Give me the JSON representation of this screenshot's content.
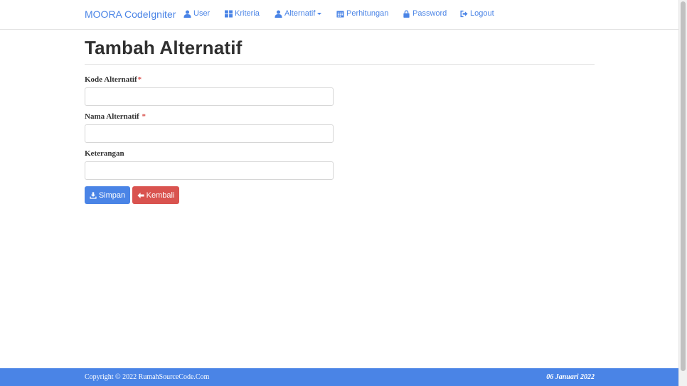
{
  "navbar": {
    "brand": "MOORA CodeIgniter",
    "items": [
      {
        "label": "User",
        "icon": "user-icon"
      },
      {
        "label": "Kriteria",
        "icon": "th-large-icon"
      },
      {
        "label": "Alternatif",
        "icon": "user-icon",
        "dropdown": true
      },
      {
        "label": "Perhitungan",
        "icon": "calendar-icon"
      },
      {
        "label": "Password",
        "icon": "lock-icon"
      },
      {
        "label": "Logout",
        "icon": "log-out-icon"
      }
    ]
  },
  "page": {
    "title": "Tambah Alternatif"
  },
  "form": {
    "kode": {
      "label": "Kode Alternatif",
      "required_mark": "*",
      "value": ""
    },
    "nama": {
      "label": "Nama Alternatif",
      "required_mark": "*",
      "value": ""
    },
    "keterangan": {
      "label": "Keterangan",
      "value": ""
    },
    "save_label": "Simpan",
    "back_label": "Kembali"
  },
  "footer": {
    "copyright": "Copyright © 2022 RumahSourceCode.Com",
    "date": "06 Januari 2022"
  },
  "colors": {
    "primary": "#4a84e6",
    "danger": "#d9534f"
  }
}
